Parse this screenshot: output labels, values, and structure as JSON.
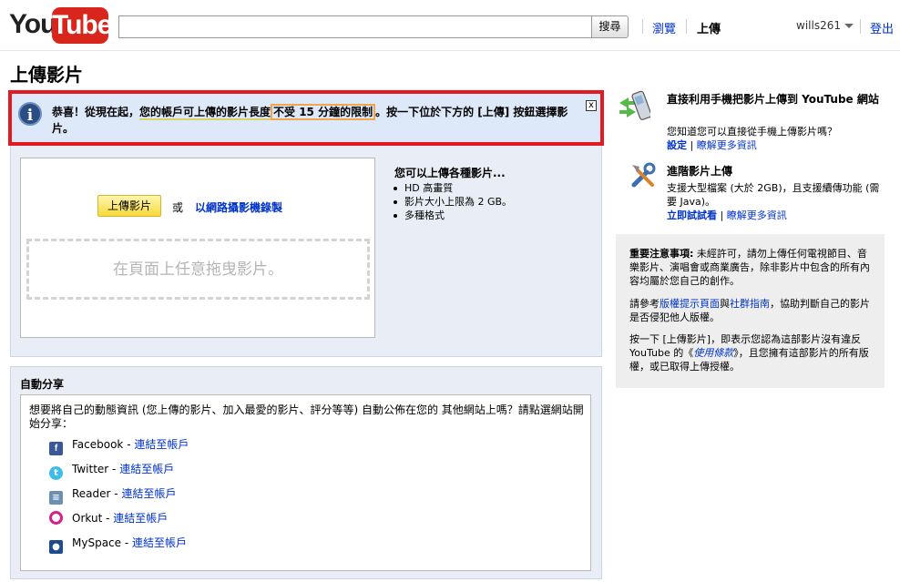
{
  "header": {
    "logo_you": "You",
    "logo_tube": "Tube",
    "search_value": "",
    "search_button": "搜尋",
    "nav_browse": "瀏覽",
    "nav_upload": "上傳",
    "username": "wills261",
    "logout": "登出"
  },
  "page_title": "上傳影片",
  "notice": {
    "part1": "恭喜！從現在起，",
    "part2": "您的帳戶可上傳的影片長度",
    "part3": "不受 15 分鐘的限制",
    "part4": "。按一下位於下方的 [上傳] 按鈕選擇影片。",
    "close": "x"
  },
  "upload": {
    "button": "上傳影片",
    "or": "或",
    "webcam_link": "以網路攝影機錄製",
    "drop_zone": "在頁面上任意拖曳影片。",
    "types_title": "您可以上傳各種影片...",
    "types": [
      "HD 高畫質",
      "影片大小上限為 2 GB。",
      "多種格式"
    ]
  },
  "share": {
    "title": "自動分享",
    "description": "想要將自己的動態資訊 (您上傳的影片、加入最愛的影片、評分等等) 自動公佈在您的 其他網站上嗎？請點選網站開始分享：",
    "connect_label": "連結至帳戶",
    "services": [
      {
        "name": "Facebook",
        "icon": "facebook-icon"
      },
      {
        "name": "Twitter",
        "icon": "twitter-icon"
      },
      {
        "name": "Reader",
        "icon": "reader-icon"
      },
      {
        "name": "Orkut",
        "icon": "orkut-icon"
      },
      {
        "name": "MySpace",
        "icon": "myspace-icon"
      }
    ]
  },
  "mobile": {
    "title": "直接利用手機把影片上傳到 YouTube 網站",
    "text": "您知道您可以直接從手機上傳影片嗎？",
    "link1": "設定",
    "link2": "瞭解更多資訊"
  },
  "advanced": {
    "title": "進階影片上傳",
    "text": "支援大型檔案 (大於 2GB)，且支援續傳功能 (需要 Java)。",
    "link1": "立即試試看",
    "link2": "瞭解更多資訊"
  },
  "notes": {
    "heading": "重要注意事項:",
    "p1_rest": " 未經許可，請勿上傳任何電視節目、音樂影片、演唱會或商業廣告，除非影片中包含的所有內容均屬於您自己的創作。",
    "p2_a": "請參考",
    "p2_link1": "版權提示頁面",
    "p2_b": "與",
    "p2_link2": "社群指南",
    "p2_c": "，協助判斷自己的影片是否侵犯他人版權。",
    "p3_a": "按一下 [上傳影片]，即表示您認為這部影片沒有違反 YouTube 的《",
    "p3_link": "使用條款",
    "p3_b": "》，且您擁有這部影片的所有版權，或已取得上傳授權。"
  },
  "colors": {
    "notice_border": "#e11b22",
    "notice_bg": "#dde8f8",
    "link": "#0033cc",
    "upload_button": "#f8da39",
    "logo_red": "#d8261c"
  }
}
